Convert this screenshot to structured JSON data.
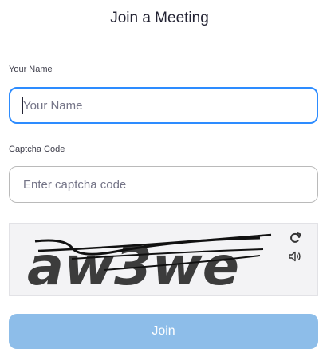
{
  "page": {
    "title": "Join a Meeting"
  },
  "form": {
    "name_label": "Your Name",
    "name_placeholder": "Your Name",
    "name_value": "",
    "captcha_label": "Captcha Code",
    "captcha_placeholder": "Enter captcha code",
    "captcha_value": ""
  },
  "captcha": {
    "image_text": "aw3we",
    "refresh_icon": "refresh-icon",
    "audio_icon": "speaker-icon"
  },
  "actions": {
    "join_label": "Join"
  },
  "colors": {
    "accent": "#2d8cff",
    "join_button_disabled": "#8dbde9",
    "captcha_bg": "#f3f3f5"
  }
}
